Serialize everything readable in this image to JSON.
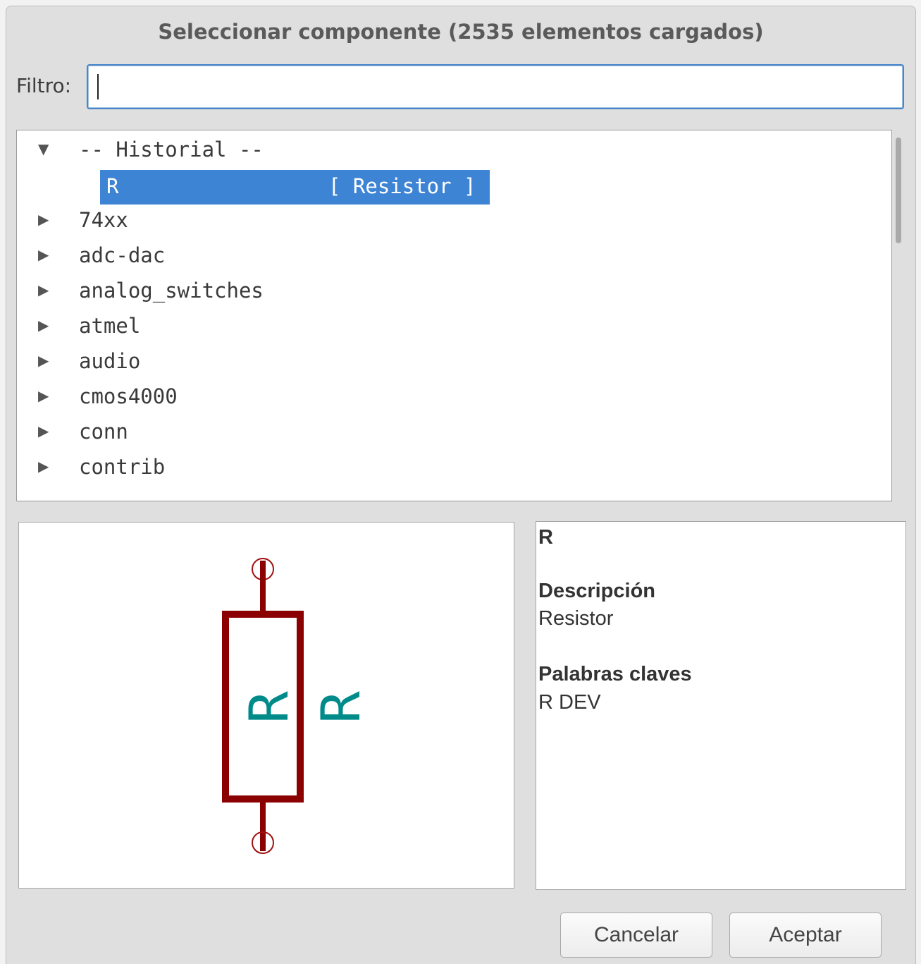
{
  "dialog": {
    "title": "Seleccionar componente (2535 elementos cargados)"
  },
  "filter": {
    "label": "Filtro:",
    "value": ""
  },
  "tree": {
    "history_arrow": "▼",
    "history_label": "-- Historial --",
    "selected_item": {
      "name": "R",
      "description": "[ Resistor ]"
    },
    "collapsed_arrow": "▶",
    "libraries": [
      "74xx",
      "adc-dac",
      "analog_switches",
      "atmel",
      "audio",
      "cmos4000",
      "conn",
      "contrib"
    ]
  },
  "preview": {
    "reference_text": "R",
    "value_text": "R",
    "body_color": "#8b0000",
    "pin_color": "#a01010",
    "text_color": "#008b8b"
  },
  "info": {
    "reference": "R",
    "description_heading": "Descripción",
    "description_value": "Resistor",
    "keywords_heading": "Palabras claves",
    "keywords_value": "R DEV"
  },
  "buttons": {
    "cancel": "Cancelar",
    "accept": "Aceptar"
  },
  "colors": {
    "selection": "#3d84d4",
    "focus_border": "#4a86c6"
  }
}
